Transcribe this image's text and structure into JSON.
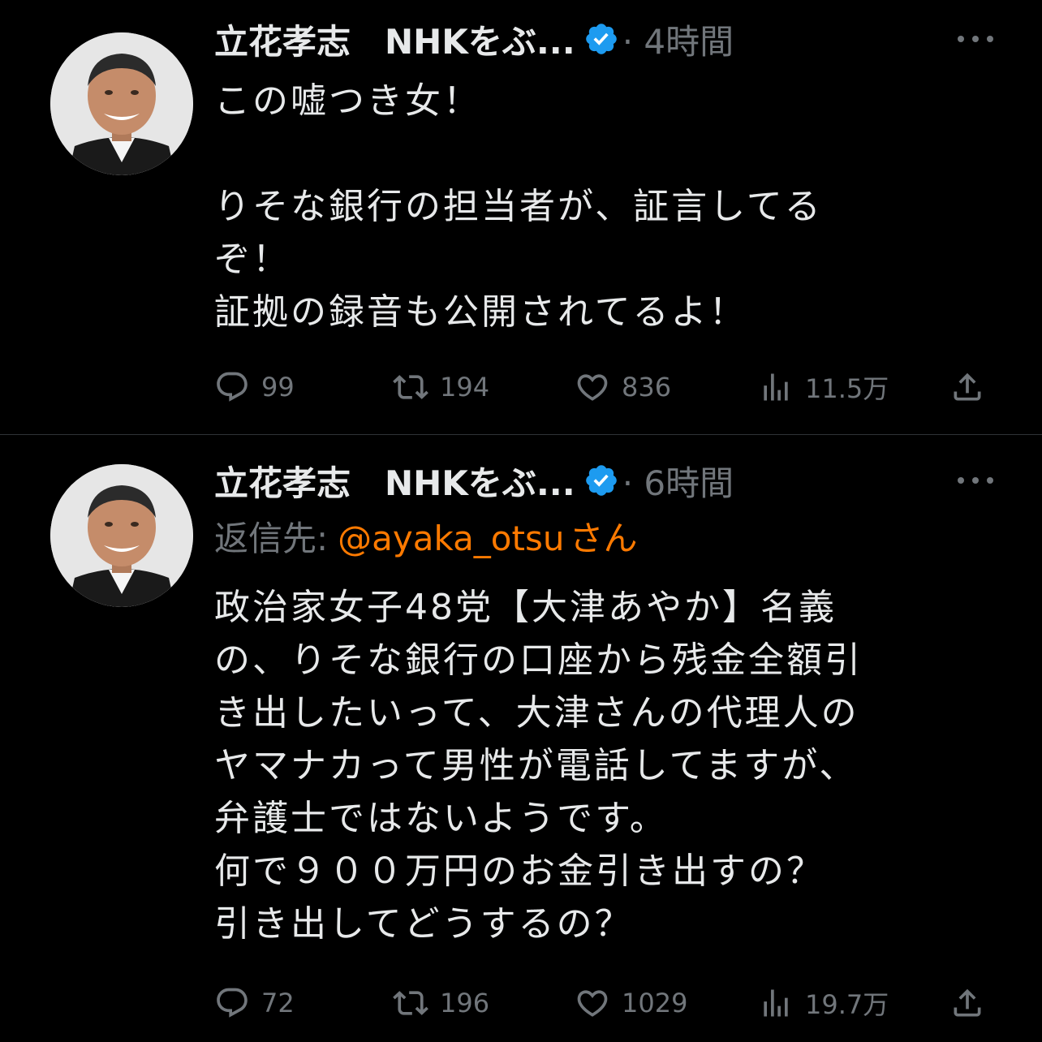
{
  "colors": {
    "background": "#000000",
    "text": "#e7e9ea",
    "muted": "#71767b",
    "verified": "#1d9bf0",
    "mention": "#ff7a00",
    "divider": "#2f3336"
  },
  "tweets": [
    {
      "author": {
        "display_name": "立花孝志　NHKをぶ...",
        "verified_icon": "verified-badge-icon"
      },
      "time": "· 4時間",
      "text": "この嘘つき女！\n\nりそな銀行の担当者が、証言してる\nぞ！\n証拠の録音も公開されてるよ！",
      "metrics": {
        "replies": "99",
        "retweets": "194",
        "likes": "836",
        "views": "11.5万"
      }
    },
    {
      "author": {
        "display_name": "立花孝志　NHKをぶ...",
        "verified_icon": "verified-badge-icon"
      },
      "time": "· 6時間",
      "reply_to": {
        "label": "返信先:",
        "handle": "@ayaka_otsu",
        "suffix": "さん"
      },
      "text": "政治家女子48党【大津あやか】名義\nの、りそな銀行の口座から残金全額引\nき出したいって、大津さんの代理人の\nヤマナカって男性が電話してますが、\n弁護士ではないようです。\n何で９００万円のお金引き出すの？\n引き出してどうするの？",
      "metrics": {
        "replies": "72",
        "retweets": "196",
        "likes": "1029",
        "views": "19.7万"
      }
    }
  ]
}
